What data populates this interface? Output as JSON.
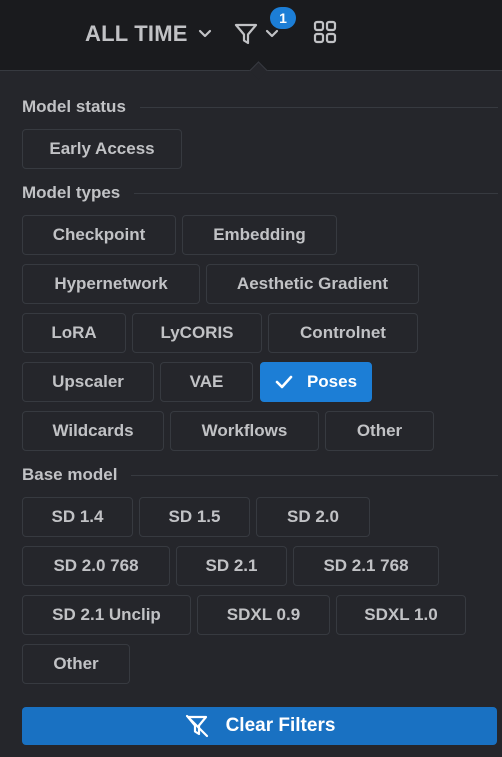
{
  "header": {
    "period_label": "ALL TIME",
    "filter_badge": "1"
  },
  "sections": {
    "model_status": {
      "label": "Model status",
      "chips": [
        {
          "label": "Early Access",
          "active": false
        }
      ]
    },
    "model_types": {
      "label": "Model types",
      "chips": [
        {
          "label": "Checkpoint",
          "active": false
        },
        {
          "label": "Embedding",
          "active": false
        },
        {
          "label": "Hypernetwork",
          "active": false
        },
        {
          "label": "Aesthetic Gradient",
          "active": false
        },
        {
          "label": "LoRA",
          "active": false
        },
        {
          "label": "LyCORIS",
          "active": false
        },
        {
          "label": "Controlnet",
          "active": false
        },
        {
          "label": "Upscaler",
          "active": false
        },
        {
          "label": "VAE",
          "active": false
        },
        {
          "label": "Poses",
          "active": true
        },
        {
          "label": "Wildcards",
          "active": false
        },
        {
          "label": "Workflows",
          "active": false
        },
        {
          "label": "Other",
          "active": false
        }
      ]
    },
    "base_model": {
      "label": "Base model",
      "chips": [
        {
          "label": "SD 1.4",
          "active": false
        },
        {
          "label": "SD 1.5",
          "active": false
        },
        {
          "label": "SD 2.0",
          "active": false
        },
        {
          "label": "SD 2.0 768",
          "active": false
        },
        {
          "label": "SD 2.1",
          "active": false
        },
        {
          "label": "SD 2.1 768",
          "active": false
        },
        {
          "label": "SD 2.1 Unclip",
          "active": false
        },
        {
          "label": "SDXL 0.9",
          "active": false
        },
        {
          "label": "SDXL 1.0",
          "active": false
        },
        {
          "label": "Other",
          "active": false
        }
      ]
    }
  },
  "clear_button": {
    "label": "Clear Filters",
    "icon": "filter-off-icon"
  },
  "icons": {
    "period": "chevron-down-icon",
    "filter": "filter-icon",
    "layout": "grid-icon",
    "active_chip": "check-icon"
  },
  "colors": {
    "accent": "#1c7ed6",
    "panel_bg": "#25262b",
    "page_bg": "#1a1b1e",
    "text": "#c1c2c5",
    "border": "#373a40"
  }
}
